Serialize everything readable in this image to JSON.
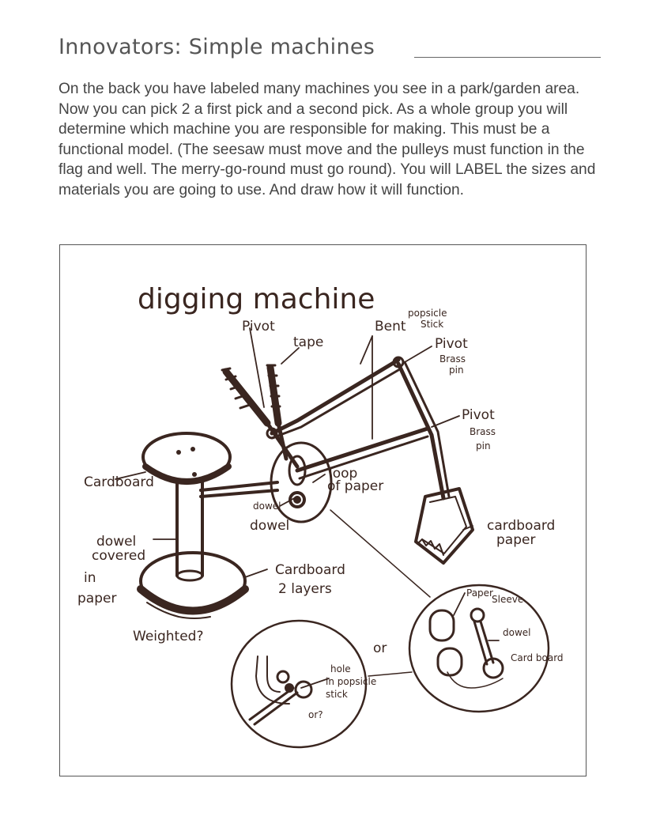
{
  "header": {
    "title": "Innovators: Simple machines"
  },
  "instructions": {
    "text": "On the back you have labeled many machines you see in a park/garden area. Now you can pick 2 a first pick and a second pick. As a whole group you will determine which machine you are responsible for making. This must be a functional model. (The seesaw must move and the pulleys must function in the flag and well. The merry-go-round must go round). You will LABEL the sizes and materials you are going to use. And draw how it will function."
  },
  "drawing": {
    "title": "digging machine",
    "labels": {
      "pivot_top": "Pivot",
      "tape": "tape",
      "bent_popsicle": "Bent",
      "popsicle": "popsicle",
      "stick": "Stick",
      "pivot_right_1": "Pivot",
      "brass_1": "Brass",
      "pin_1": "pin",
      "pivot_right_2": "Pivot",
      "brass_2": "Brass",
      "pin_2": "pin",
      "cardboard_left": "Cardboard",
      "loop": "loop",
      "of_paper": "of paper",
      "dowel_small": "dowel",
      "dowel_big": "dowel",
      "dowel_covered": "dowel",
      "covered": "covered",
      "in": "in",
      "paper": "paper",
      "cardboard_bottom": "Cardboard",
      "two_layers": "2 layers",
      "cardboard_paper_1": "cardboard",
      "cardboard_paper_2": "paper",
      "weighted": "Weighted?",
      "or": "or",
      "hole": "hole",
      "in_popsicle": "in popsicle",
      "stick_or": "stick",
      "or_q": "or?",
      "paper_sleeve": "Paper",
      "sleeve": "Sleeve",
      "dowel_right": "dowel",
      "card_board": "Card board"
    }
  }
}
